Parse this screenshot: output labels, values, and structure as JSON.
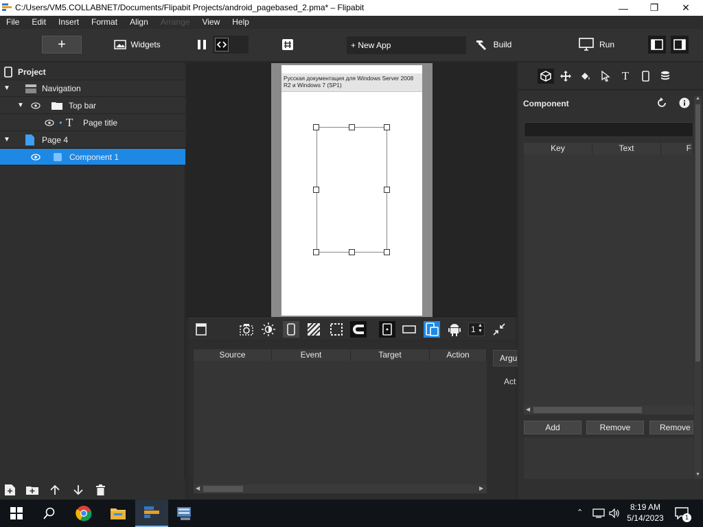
{
  "window": {
    "title": "C:/Users/VM5.COLLABNET/Documents/Flipabit Projects/android_pagebased_2.pma* – Flipabit"
  },
  "menu": [
    "File",
    "Edit",
    "Insert",
    "Format",
    "Align",
    "Arrange",
    "View",
    "Help"
  ],
  "toolbar": {
    "widgets": "Widgets",
    "new_app": "+ New App",
    "build": "Build",
    "run": "Run"
  },
  "project": {
    "header": "Project",
    "rows": [
      "Navigation",
      "Top bar",
      "Page title",
      "Page 4",
      "Component 1"
    ]
  },
  "canvas": {
    "page_title": "Русская документация для Windows Server 2008 R2 и Windows 7 (SP1)"
  },
  "canvas_toolbar": {
    "counter": "1"
  },
  "events": {
    "columns": [
      "Source",
      "Event",
      "Target",
      "Action"
    ],
    "args_tab": "Argu",
    "act_label": "Act"
  },
  "component": {
    "title": "Component",
    "columns": [
      "Key",
      "Text",
      "F"
    ],
    "buttons": [
      "Add",
      "Remove",
      "Remove a"
    ]
  },
  "taskbar": {
    "time": "8:19 AM",
    "date": "5/14/2023",
    "notifications": "1"
  },
  "colors": {
    "accent": "#1e88e5",
    "panel": "#2f2f2f",
    "canvas": "#252525"
  }
}
